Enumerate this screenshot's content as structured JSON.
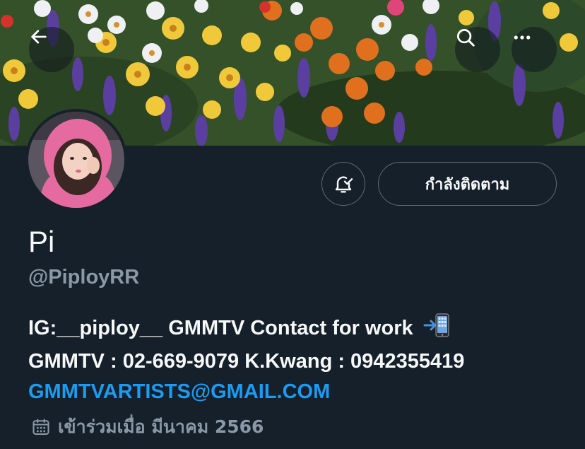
{
  "banner": {
    "back_icon": "arrow-left-icon",
    "search_icon": "search-icon",
    "more_icon": "more-horizontal-icon"
  },
  "profile": {
    "display_name": "Pi",
    "handle": "@PiployRR",
    "bio_line1": "IG:__piploy__ GMMTV Contact for work",
    "bio_emoji": "mobile-phone-arrow-icon",
    "bio_line2": "GMMTV : 02-669-9079 K.Kwang : 0942355419",
    "bio_email": "GMMTVARTISTS@GMAIL.COM",
    "joined_text": "เข้าร่วมเมื่อ มีนาคม 2566",
    "joined_icon": "calendar-icon"
  },
  "actions": {
    "notify_icon": "bell-check-icon",
    "follow_label": "กำลังติดตาม"
  },
  "colors": {
    "background": "#15202b",
    "text_primary": "#f7f9f9",
    "text_secondary": "#8b98a5",
    "link": "#1d9bf0",
    "border": "#5b6b78"
  }
}
